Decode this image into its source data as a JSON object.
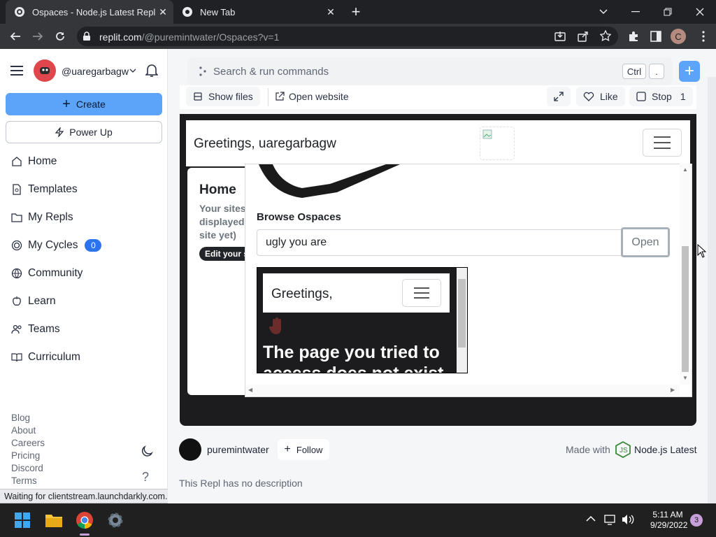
{
  "browser": {
    "tabs": [
      {
        "title": "Ospaces - Node.js Latest Repl - R",
        "active": true
      },
      {
        "title": "New Tab",
        "active": false
      }
    ],
    "url_host": "replit.com",
    "url_path": "/@puremintwater/Ospaces?v=1",
    "profile_initial": "C",
    "status_text": "Waiting for clientstream.launchdarkly.com..."
  },
  "sidebar": {
    "username": "@uaregarbagw",
    "create_label": "Create",
    "powerup_label": "Power Up",
    "nav": [
      {
        "label": "Home",
        "icon": "home-icon"
      },
      {
        "label": "Templates",
        "icon": "templates-icon"
      },
      {
        "label": "My Repls",
        "icon": "folder-icon"
      },
      {
        "label": "My Cycles",
        "icon": "cycles-icon",
        "badge": "0"
      },
      {
        "label": "Community",
        "icon": "globe-icon"
      },
      {
        "label": "Learn",
        "icon": "learn-icon"
      },
      {
        "label": "Teams",
        "icon": "teams-icon"
      },
      {
        "label": "Curriculum",
        "icon": "book-icon"
      }
    ],
    "footer_links": [
      "Blog",
      "About",
      "Careers",
      "Pricing",
      "Discord",
      "Terms"
    ],
    "help_glyph": "?"
  },
  "search": {
    "placeholder": "Search & run commands",
    "kbd_ctrl": "Ctrl",
    "kbd_dot": "."
  },
  "replbar": {
    "show_files": "Show files",
    "open_website": "Open website",
    "like": "Like",
    "stop": "Stop",
    "count": "1"
  },
  "site": {
    "greeting": "Greetings, uaregarbagw",
    "home_title": "Home",
    "home_text_1": "Your sites",
    "home_text_2": "displayed",
    "home_text_3": "site yet)",
    "edit_button": "Edit your s",
    "browse_label": "Browse Ospaces",
    "browse_value": "ugly you are",
    "open_button": "Open",
    "preview_greeting": "Greetings,",
    "preview_heading_1": "The page you tried to",
    "preview_heading_2": "access does not exist"
  },
  "owner": {
    "name": "puremintwater",
    "follow_label": "Follow",
    "made_with_prefix": "Made with",
    "made_with_lang": "Node.js Latest",
    "description": "This Repl has no description"
  },
  "taskbar": {
    "time": "5:11 AM",
    "date": "9/29/2022",
    "notification_count": "3"
  },
  "colors": {
    "create_button": "#5ca4fa",
    "chrome_dark": "#202124",
    "chrome_toolbar": "#35363a",
    "avatar_red": "#e0474c",
    "badge_blue": "#2b74f0",
    "node_green": "#3c873a"
  }
}
